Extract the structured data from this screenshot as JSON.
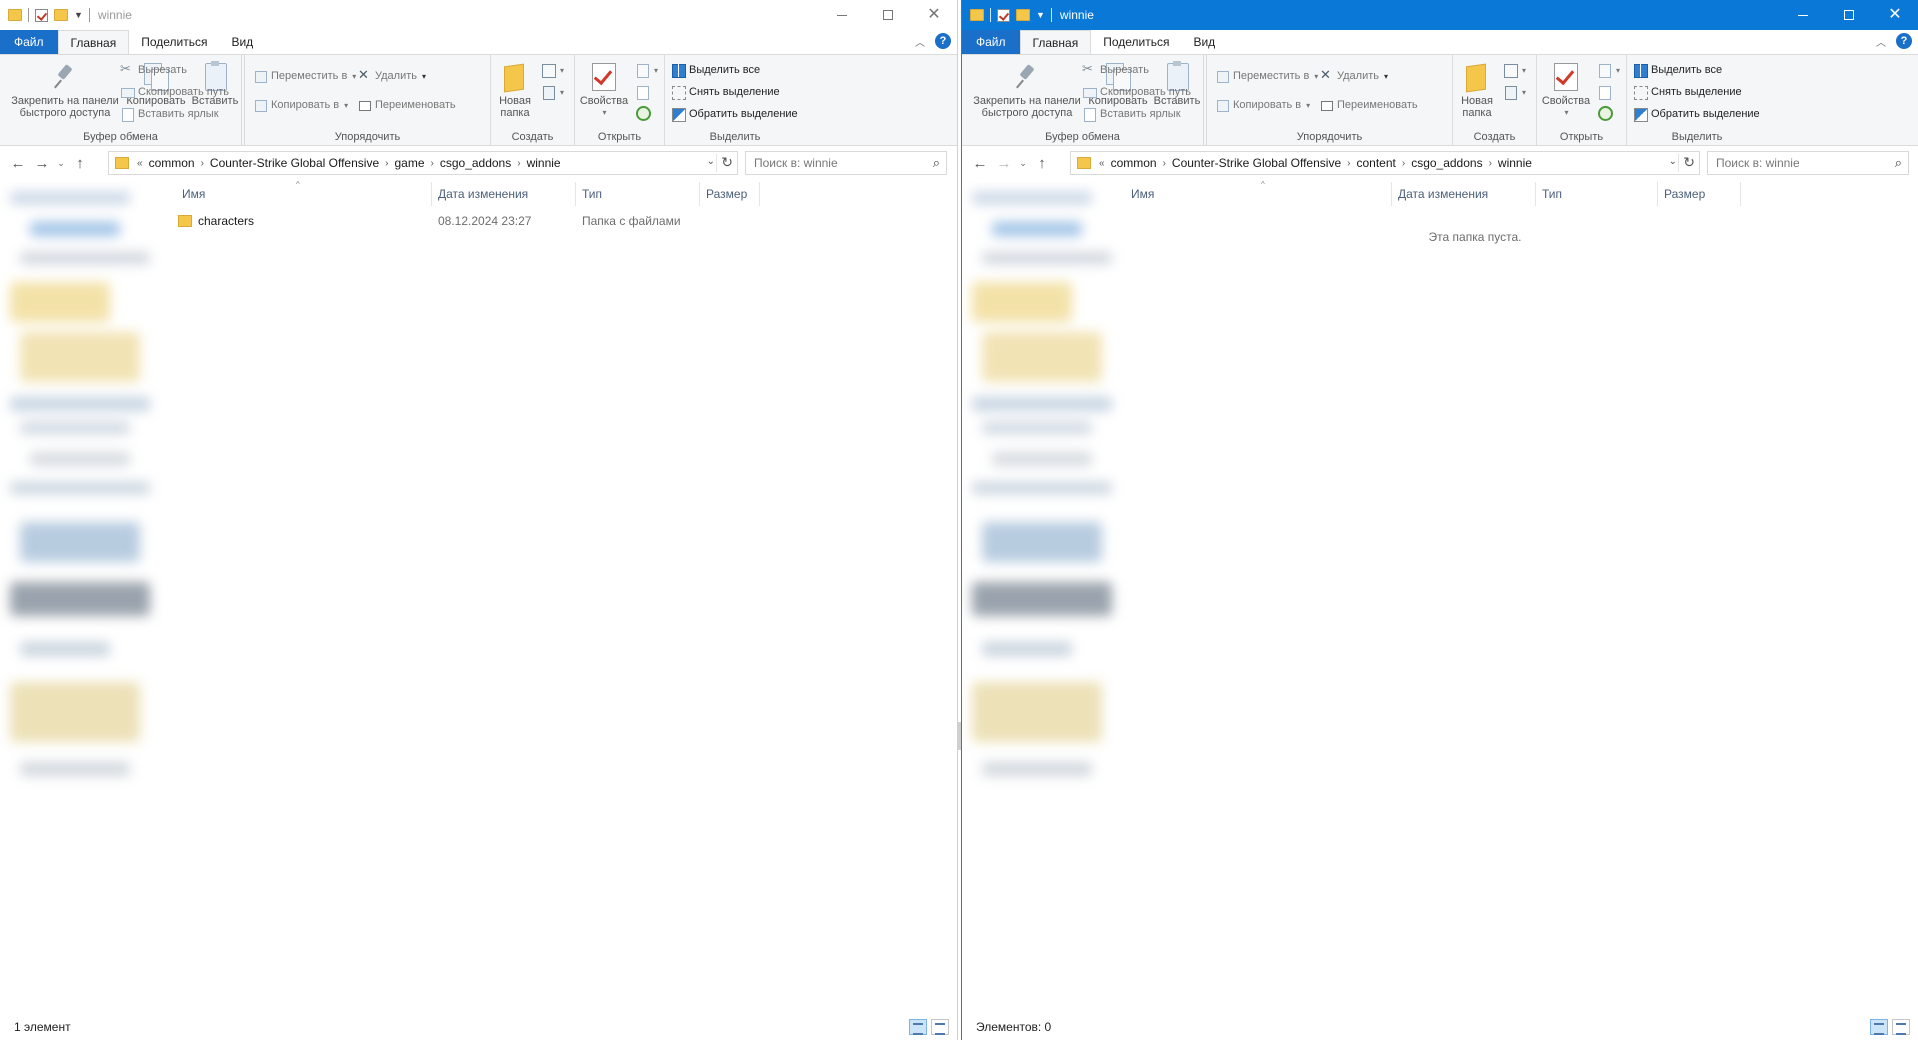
{
  "colors": {
    "accent_blue": "#0a78d7",
    "file_tab": "#1a6fc9",
    "folder_yellow": "#f4c74a",
    "header_text": "#4c607a"
  },
  "windows": [
    {
      "id": "left",
      "title": "winnie",
      "tabs": {
        "file": "Файл",
        "home": "Главная",
        "share": "Поделиться",
        "view": "Вид"
      },
      "ribbon": {
        "clipboard": {
          "pin": "Закрепить на панели быстрого доступа",
          "pin_line1": "Закрепить на панели",
          "pin_line2": "быстрого доступа",
          "copy": "Копировать",
          "paste": "Вставить",
          "cut": "Вырезать",
          "copy_path": "Скопировать путь",
          "paste_shortcut": "Вставить ярлык",
          "label": "Буфер обмена"
        },
        "organize": {
          "move_to": "Переместить в",
          "copy_to": "Копировать в",
          "delete": "Удалить",
          "rename": "Переименовать",
          "label": "Упорядочить"
        },
        "new": {
          "new_folder_line1": "Новая",
          "new_folder_line2": "папка",
          "label": "Создать"
        },
        "open": {
          "properties": "Свойства",
          "label": "Открыть"
        },
        "select": {
          "select_all": "Выделить все",
          "select_none": "Снять выделение",
          "invert": "Обратить выделение",
          "label": "Выделить"
        }
      },
      "address": {
        "overflow": "«",
        "crumbs": [
          "common",
          "Counter-Strike Global Offensive",
          "game",
          "csgo_addons",
          "winnie"
        ]
      },
      "search_placeholder": "Поиск в: winnie",
      "columns": {
        "name": "Имя",
        "date": "Дата изменения",
        "type": "Тип",
        "size": "Размер"
      },
      "rows": [
        {
          "name": "characters",
          "date": "08.12.2024 23:27",
          "type": "Папка с файлами",
          "size": ""
        }
      ],
      "empty_message": "",
      "status": "1 элемент"
    },
    {
      "id": "right",
      "title": "winnie",
      "tabs": {
        "file": "Файл",
        "home": "Главная",
        "share": "Поделиться",
        "view": "Вид"
      },
      "ribbon": {
        "clipboard": {
          "pin_line1": "Закрепить на панели",
          "pin_line2": "быстрого доступа",
          "copy": "Копировать",
          "paste": "Вставить",
          "cut": "Вырезать",
          "copy_path": "Скопировать путь",
          "paste_shortcut": "Вставить ярлык",
          "label": "Буфер обмена"
        },
        "organize": {
          "move_to": "Переместить в",
          "copy_to": "Копировать в",
          "delete": "Удалить",
          "rename": "Переименовать",
          "label": "Упорядочить"
        },
        "new": {
          "new_folder_line1": "Новая",
          "new_folder_line2": "папка",
          "label": "Создать"
        },
        "open": {
          "properties": "Свойства",
          "label": "Открыть"
        },
        "select": {
          "select_all": "Выделить все",
          "select_none": "Снять выделение",
          "invert": "Обратить выделение",
          "label": "Выделить"
        }
      },
      "address": {
        "overflow": "«",
        "crumbs": [
          "common",
          "Counter-Strike Global Offensive",
          "content",
          "csgo_addons",
          "winnie"
        ]
      },
      "search_placeholder": "Поиск в: winnie",
      "columns": {
        "name": "Имя",
        "date": "Дата изменения",
        "type": "Тип",
        "size": "Размер"
      },
      "rows": [],
      "empty_message": "Эта папка пуста.",
      "status": "Элементов: 0"
    }
  ]
}
